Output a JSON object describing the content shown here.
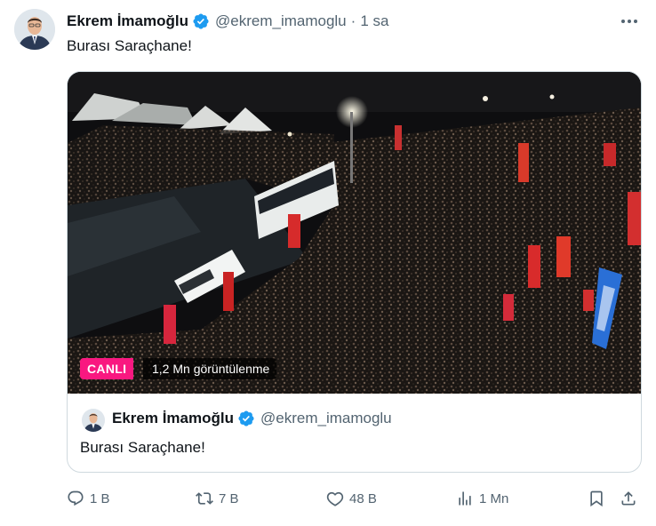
{
  "tweet": {
    "author": {
      "display_name": "Ekrem İmamoğlu",
      "handle": "@ekrem_imamoglu",
      "verified_icon": "verified-badge-icon"
    },
    "separator": "·",
    "time": "1 sa",
    "text": "Burası Saraçhane!",
    "media": {
      "live_label": "CANLI",
      "views_label": "1,2 Mn görüntülenme",
      "description_icon": "live-video-thumbnail"
    },
    "quote": {
      "display_name": "Ekrem İmamoğlu",
      "handle": "@ekrem_imamoglu",
      "text": "Burası Saraçhane!"
    },
    "actions": {
      "replies": "1 B",
      "reposts": "7 B",
      "likes": "48 B",
      "views": "1 Mn"
    }
  },
  "colors": {
    "text_primary": "#0f1419",
    "text_secondary": "#536471",
    "verified_blue": "#1d9bf0",
    "live_pink": "#f91880",
    "border": "#cfd9de"
  }
}
